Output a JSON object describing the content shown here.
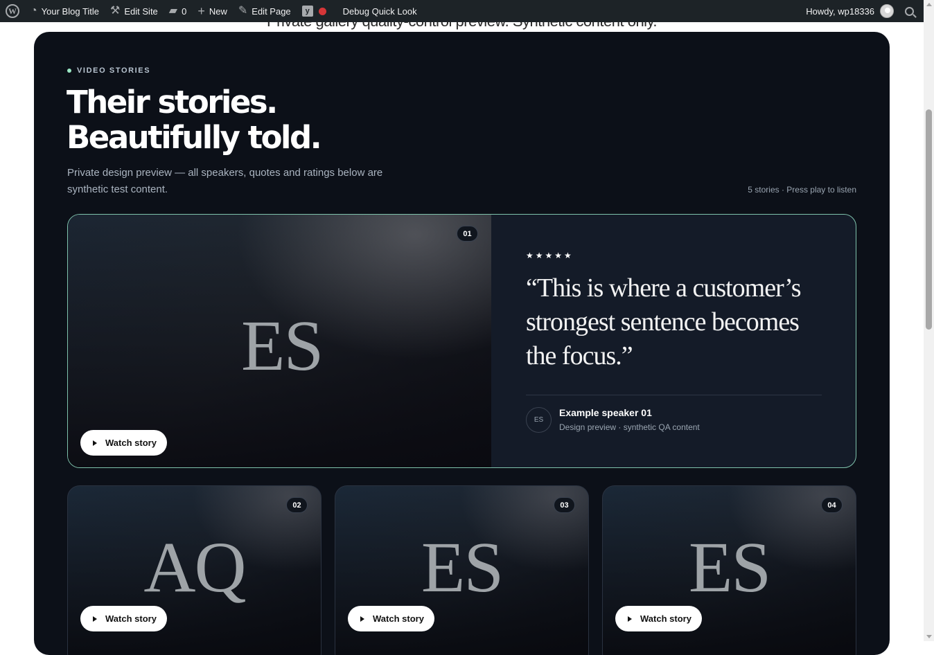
{
  "adminbar": {
    "site_title": "Your Blog Title",
    "edit_site": "Edit Site",
    "comments_count": "0",
    "new_label": "New",
    "edit_page": "Edit Page",
    "debug": "Debug Quick Look",
    "howdy": "Howdy, wp18336"
  },
  "page": {
    "intro": "Private gallery quality-control preview. Synthetic content only."
  },
  "section": {
    "eyebrow": "VIDEO STORIES",
    "headline_line1": "Their stories.",
    "headline_line2": "Beautifully told.",
    "subtext": "Private design preview — all speakers, quotes and ratings below are synthetic test content.",
    "count_text": "5 stories · Press play to listen"
  },
  "feature": {
    "number": "01",
    "initials": "ES",
    "watch_label": "Watch story",
    "stars": "★★★★★",
    "rating": 5,
    "quote": "“This is where a customer’s strongest sentence becomes the focus.”",
    "speaker_initials": "ES",
    "speaker_name": "Example speaker 01",
    "speaker_role": "Design preview · synthetic QA content"
  },
  "cards": [
    {
      "number": "02",
      "initials": "AQ",
      "watch_label": "Watch story"
    },
    {
      "number": "03",
      "initials": "ES",
      "watch_label": "Watch story"
    },
    {
      "number": "04",
      "initials": "ES",
      "watch_label": "Watch story"
    }
  ],
  "colors": {
    "adminbar_bg": "#1d2327",
    "section_bg": "#0c1018",
    "accent_mint": "#9be7c4",
    "feature_border": "#7fc3ac",
    "debug_dot": "#d63638"
  }
}
